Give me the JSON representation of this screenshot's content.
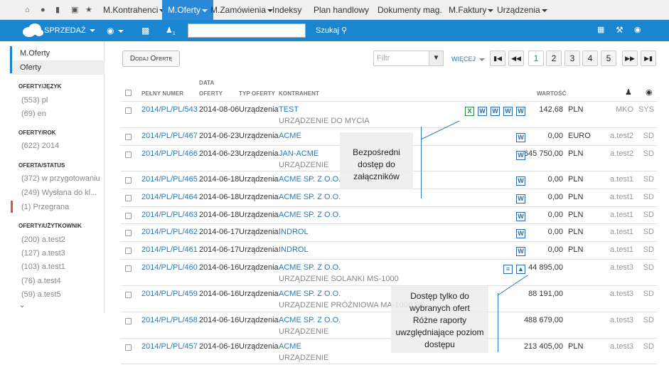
{
  "topnav": {
    "menus": [
      "M.Kontrahenci",
      "M.Oferty",
      "M.Zamówienia",
      "Indeksy",
      "Plan handlowy",
      "Dokumenty mag.",
      "M.Faktury",
      "Urządzenia"
    ]
  },
  "bluebar": {
    "brand": "SPRZEDAŻ",
    "user_sub": "1",
    "search_placeholder": "",
    "search_label": "Szukaj"
  },
  "sidebar": {
    "title": "M.Oferty",
    "subtitle": "Oferty",
    "sections": [
      {
        "head": "OFERTY/JĘZYK",
        "items": [
          "(553) pl",
          "(69) en"
        ]
      },
      {
        "head": "OFERTY/ROK",
        "items": [
          "(622) 2014"
        ]
      },
      {
        "head": "OFERTA/STATUS",
        "items": [
          "(372) w przygotowaniu",
          "(249) Wysłana do kl...",
          "(1) Przegrana"
        ]
      },
      {
        "head": "OFERTY/UŻYTKOWNIK",
        "items": [
          "(200) a.test2",
          "(127) a.test3",
          "(103) a.test1",
          "(76) a.test4",
          "(59) a.test5"
        ]
      }
    ]
  },
  "toolbar": {
    "add_offer": "Dodaj Ofertę",
    "filter_placeholder": "Filtr",
    "more": "WIĘCEJ",
    "pages": [
      "1",
      "2",
      "3",
      "4",
      "5"
    ]
  },
  "table": {
    "headers": {
      "number": "PEŁNY NUMER",
      "date1": "DATA",
      "date2": "OFERTY",
      "type": "TYP OFERTY",
      "client": "KONTRAHENT",
      "value": "WARTOŚĆ"
    },
    "rows": [
      {
        "num": "2014/PL/PL/543",
        "date": "2014-08-06",
        "type": "Urządzenia",
        "client": "TEST",
        "desc": "URZĄDZENIE DO MYCIA",
        "value": "142,68",
        "cur": "PLN",
        "user": "MKO",
        "src": "SYS",
        "docs": [
          "X",
          "W",
          "W",
          "W",
          "W"
        ]
      },
      {
        "num": "2014/PL/PL/467",
        "date": "2014-06-23",
        "type": "Urządzenia",
        "client": "ACME",
        "desc": "",
        "value": "0,00",
        "cur": "EURO",
        "user": "a.test2",
        "src": "SD",
        "docs": [
          "W"
        ]
      },
      {
        "num": "2014/PL/PL/466",
        "date": "2014-06-23",
        "type": "Urządzenia",
        "client": "JAN-ACME",
        "desc": "URZĄDZENIE",
        "value": "645 750,00",
        "cur": "PLN",
        "user": "a.test2",
        "src": "SD",
        "docs": [
          "W"
        ]
      },
      {
        "num": "2014/PL/PL/465",
        "date": "2014-06-18",
        "type": "Urządzenia",
        "client": "ACME SP. Z O.O.",
        "desc": "",
        "value": "0,00",
        "cur": "PLN",
        "user": "a.test1",
        "src": "SD",
        "docs": [
          "W"
        ]
      },
      {
        "num": "2014/PL/PL/464",
        "date": "2014-06-18",
        "type": "Urządzenia",
        "client": "ACME SP. Z O.O.",
        "desc": "",
        "value": "0,00",
        "cur": "PLN",
        "user": "a.test1",
        "src": "SD",
        "docs": [
          "W"
        ]
      },
      {
        "num": "2014/PL/PL/463",
        "date": "2014-06-18",
        "type": "Urządzenia",
        "client": "ACME SP. Z O.O.",
        "desc": "",
        "value": "0,00",
        "cur": "PLN",
        "user": "a.test1",
        "src": "SD",
        "docs": [
          "W"
        ]
      },
      {
        "num": "2014/PL/PL/462",
        "date": "2014-06-17",
        "type": "Urządzenia",
        "client": "INDROL",
        "desc": "",
        "value": "0,00",
        "cur": "PLN",
        "user": "a.test1",
        "src": "SD",
        "docs": [
          "W"
        ]
      },
      {
        "num": "2014/PL/PL/461",
        "date": "2014-06-17",
        "type": "Urządzenia",
        "client": "INDROL",
        "desc": "",
        "value": "0,00",
        "cur": "PLN",
        "user": "a.test1",
        "src": "SD",
        "docs": [
          "W"
        ]
      },
      {
        "num": "2014/PL/PL/460",
        "date": "2014-06-16",
        "type": "Urządzenia",
        "client": "ACME SP. Z O.O.",
        "desc": "URZĄDZENIE SOLANKI MS-1000",
        "value": "44 895,00",
        "cur": "",
        "user": "a.test3",
        "src": "SD",
        "docs": [
          "R",
          "I"
        ]
      },
      {
        "num": "2014/PL/PL/459",
        "date": "2014-06-16",
        "type": "Urządzenia",
        "client": "ACME SP. Z O.O.",
        "desc": "URZĄDZENIE PRÓŻNIOWA MA-1000 PS",
        "value": "88 191,00",
        "cur": "",
        "user": "a.test3",
        "src": "SD",
        "docs": []
      },
      {
        "num": "2014/PL/PL/458",
        "date": "2014-06-16",
        "type": "Urządzenia",
        "client": "ACME SP. Z O.O.",
        "desc": "URZĄDZENIE",
        "value": "488 679,00",
        "cur": "",
        "user": "a.test3",
        "src": "SD",
        "docs": []
      },
      {
        "num": "2014/PL/PL/457",
        "date": "2014-06-16",
        "type": "Urządzenia",
        "client": "ACME",
        "desc": "URZĄDZENIE",
        "value": "213 405,00",
        "cur": "PLN",
        "user": "a.test3",
        "src": "SD",
        "docs": []
      }
    ]
  },
  "callouts": {
    "attachments": [
      "Bezpośredni",
      "dostęp do",
      "załączników"
    ],
    "access": [
      "Dostęp tylko do",
      "wybranych  ofert",
      "Różne raporty",
      "uwzględniające  poziom",
      "dostępu"
    ]
  }
}
